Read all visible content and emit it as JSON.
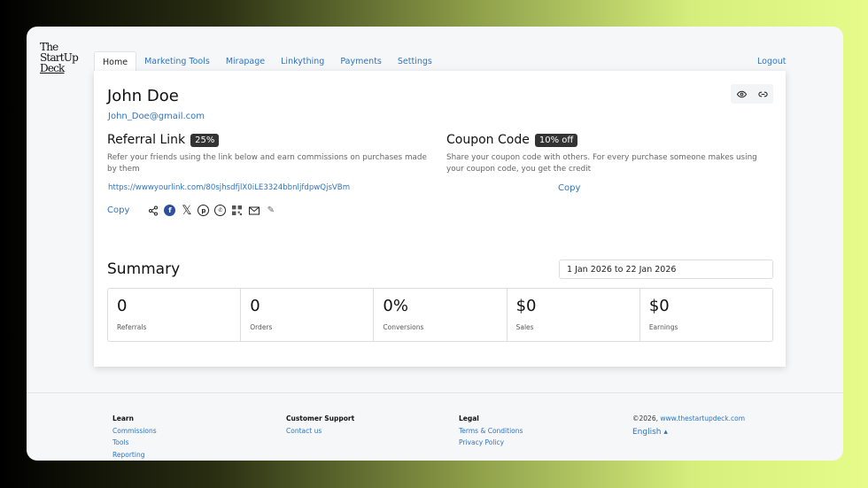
{
  "logo": "The StartUp Deck",
  "tabs": [
    "Home",
    "Marketing Tools",
    "Mirapage",
    "Linkything",
    "Payments",
    "Settings"
  ],
  "logout": "Logout",
  "user": {
    "name": "John Doe",
    "email": "John_Doe@gmail.com"
  },
  "referral": {
    "title": "Referral Link",
    "badge": "25%",
    "desc": "Refer your friends using the link below and earn commissions on purchases made by them",
    "link": "https://wwwyourlink.com/80sjhsdfjlX0iLE3324bbnljfdpwQjsVBm",
    "copy": "Copy"
  },
  "coupon": {
    "title": "Coupon Code",
    "badge": "10% off",
    "desc": "Share your coupon code with others. For every purchase someone makes using your coupon code, you get the credit",
    "copy": "Copy"
  },
  "summary": {
    "title": "Summary",
    "date_range": "1 Jan 2026 to 22 Jan 2026",
    "stats": [
      {
        "value": "0",
        "label": "Referrals"
      },
      {
        "value": "0",
        "label": "Orders"
      },
      {
        "value": "0%",
        "label": "Conversions"
      },
      {
        "value": "$0",
        "label": "Sales"
      },
      {
        "value": "$0",
        "label": "Earnings"
      }
    ]
  },
  "footer": {
    "learn": {
      "title": "Learn",
      "links": [
        "Commissions",
        "Tools",
        "Reporting"
      ]
    },
    "support": {
      "title": "Customer Support",
      "links": [
        "Contact us"
      ]
    },
    "legal": {
      "title": "Legal",
      "links": [
        "Terms & Conditions",
        "Privacy Policy"
      ]
    },
    "copyright": "©2026,",
    "site": "www.thestartupdeck.com",
    "language": "English ▴"
  }
}
